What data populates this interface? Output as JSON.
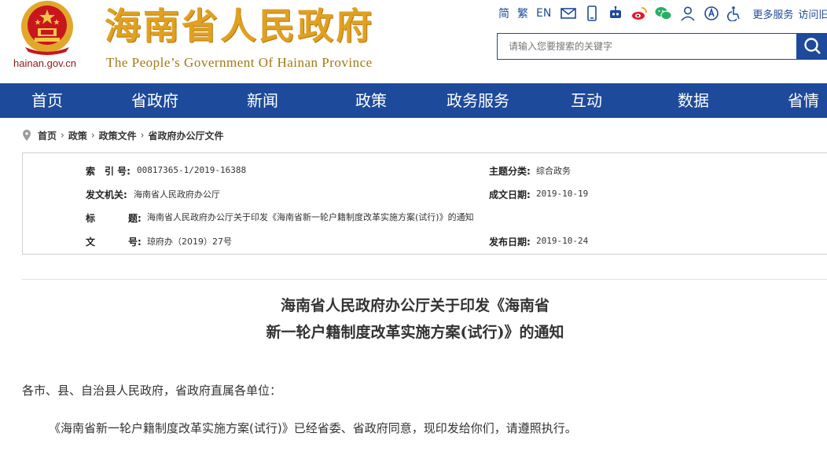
{
  "header": {
    "domain": "hainan.gov.cn",
    "title": "海南省人民政府",
    "subtitle": "The People’s Government Of Hainan Province",
    "links": {
      "simplified": "简",
      "traditional": "繁",
      "english": "EN",
      "more": "更多服务",
      "visit": "访问旧"
    },
    "icons": [
      "mail-icon",
      "mobile-icon",
      "robot-icon",
      "weibo-icon",
      "wechat-icon",
      "user-icon",
      "elderly-mode-icon",
      "accessibility-icon"
    ],
    "search_placeholder": "请输入您要搜索的关键字"
  },
  "nav": [
    "首页",
    "省政府",
    "新闻",
    "政策",
    "政务服务",
    "互动",
    "数据",
    "省情"
  ],
  "breadcrumb": [
    "首页",
    "政策",
    "政策文件",
    "省政府办公厅文件"
  ],
  "info": {
    "index_label": "索　引 号:",
    "index_value": "00817365-1/2019-16388",
    "category_label": "主题分类:",
    "category_value": "综合政务",
    "issuer_label": "发文机关:",
    "issuer_value": "海南省人民政府办公厅",
    "created_label": "成文日期:",
    "created_value": "2019-10-19",
    "title_label_a": "标",
    "title_label_b": "题:",
    "title_value": "海南省人民政府办公厅关于印发《海南省新一轮户籍制度改革实施方案(试行)》的通知",
    "docno_label_a": "文",
    "docno_label_b": "号:",
    "docno_value": "琼府办（2019）27号",
    "published_label": "发布日期:",
    "published_value": "2019-10-24"
  },
  "document": {
    "title_line1": "海南省人民政府办公厅关于印发《海南省",
    "title_line2": "新一轮户籍制度改革实施方案(试行)》的通知",
    "salutation": "各市、县、自治县人民政府，省政府直属各单位：",
    "body": "《海南省新一轮户籍制度改革实施方案(试行)》已经省委、省政府同意，现印发给你们，请遵照执行。"
  },
  "colors": {
    "brand_blue": "#1d4a9b",
    "title_gold": "#e0a020",
    "emblem_red": "#c8161d"
  }
}
